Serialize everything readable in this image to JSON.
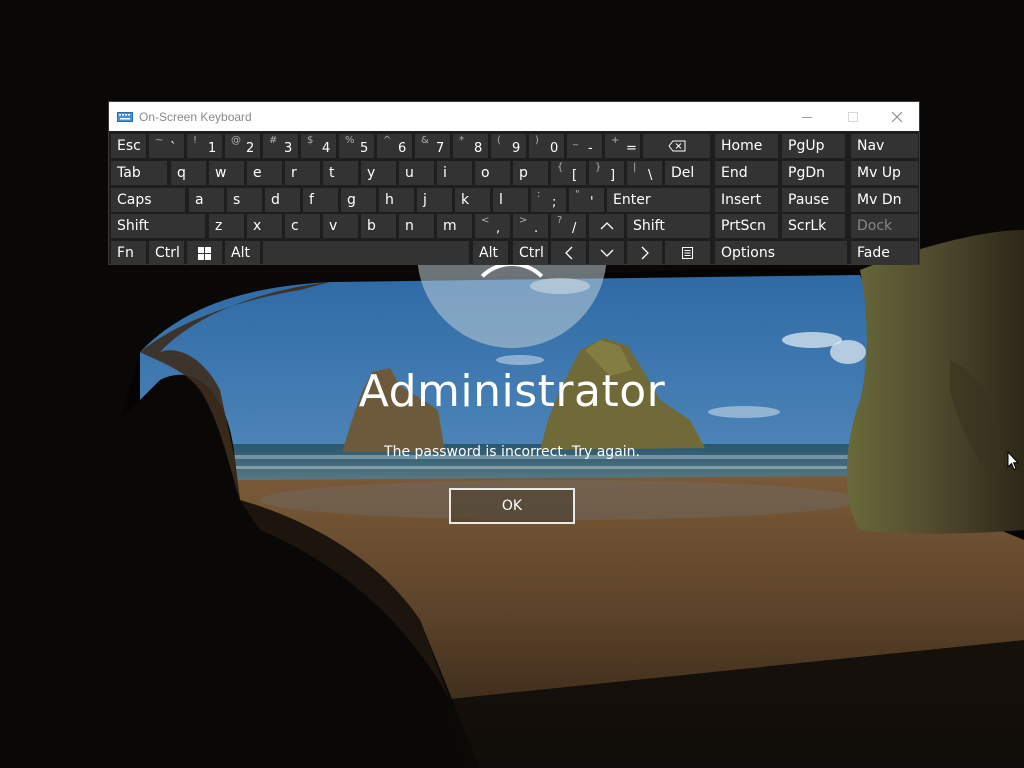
{
  "login": {
    "user_name": "Administrator",
    "message": "The password is incorrect. Try again.",
    "ok_label": "OK"
  },
  "osk": {
    "title": "On-Screen Keyboard",
    "rows": [
      [
        {
          "id": "esc",
          "label": "Esc"
        },
        {
          "id": "tilde",
          "symbol": "~",
          "main": "`"
        },
        {
          "id": "k1",
          "symbol": "!",
          "main": "1"
        },
        {
          "id": "k2",
          "symbol": "@",
          "main": "2"
        },
        {
          "id": "k3",
          "symbol": "#",
          "main": "3"
        },
        {
          "id": "k4",
          "symbol": "$",
          "main": "4"
        },
        {
          "id": "k5",
          "symbol": "%",
          "main": "5"
        },
        {
          "id": "k6",
          "symbol": "^",
          "main": "6"
        },
        {
          "id": "k7",
          "symbol": "&",
          "main": "7"
        },
        {
          "id": "k8",
          "symbol": "*",
          "main": "8"
        },
        {
          "id": "k9",
          "symbol": "(",
          "main": "9"
        },
        {
          "id": "k0",
          "symbol": ")",
          "main": "0"
        },
        {
          "id": "minus",
          "symbol": "_",
          "main": "-"
        },
        {
          "id": "equals",
          "symbol": "+",
          "main": "="
        },
        {
          "id": "backspace",
          "icon": "backspace-icon"
        },
        {
          "id": "home",
          "label": "Home"
        },
        {
          "id": "pgup",
          "label": "PgUp"
        },
        {
          "id": "nav",
          "label": "Nav"
        }
      ],
      [
        {
          "id": "tab",
          "label": "Tab"
        },
        {
          "id": "q",
          "label": "q"
        },
        {
          "id": "w",
          "label": "w"
        },
        {
          "id": "e",
          "label": "e"
        },
        {
          "id": "r",
          "label": "r"
        },
        {
          "id": "t",
          "label": "t"
        },
        {
          "id": "y",
          "label": "y"
        },
        {
          "id": "u",
          "label": "u"
        },
        {
          "id": "i",
          "label": "i"
        },
        {
          "id": "o",
          "label": "o"
        },
        {
          "id": "p",
          "label": "p"
        },
        {
          "id": "lbracket",
          "symbol": "{",
          "main": "["
        },
        {
          "id": "rbracket",
          "symbol": "}",
          "main": "]"
        },
        {
          "id": "backslash",
          "symbol": "|",
          "main": "\\"
        },
        {
          "id": "del",
          "label": "Del"
        },
        {
          "id": "end",
          "label": "End"
        },
        {
          "id": "pgdn",
          "label": "PgDn"
        },
        {
          "id": "mvup",
          "label": "Mv Up"
        }
      ],
      [
        {
          "id": "caps",
          "label": "Caps"
        },
        {
          "id": "a",
          "label": "a"
        },
        {
          "id": "s",
          "label": "s"
        },
        {
          "id": "d",
          "label": "d"
        },
        {
          "id": "f",
          "label": "f"
        },
        {
          "id": "g",
          "label": "g"
        },
        {
          "id": "h",
          "label": "h"
        },
        {
          "id": "j",
          "label": "j"
        },
        {
          "id": "k",
          "label": "k"
        },
        {
          "id": "l",
          "label": "l"
        },
        {
          "id": "semicolon",
          "symbol": ":",
          "main": ";"
        },
        {
          "id": "quote",
          "symbol": "\"",
          "main": "'"
        },
        {
          "id": "enter",
          "label": "Enter"
        },
        {
          "id": "insert",
          "label": "Insert"
        },
        {
          "id": "pause",
          "label": "Pause"
        },
        {
          "id": "mvdn",
          "label": "Mv Dn"
        }
      ],
      [
        {
          "id": "lshift",
          "label": "Shift"
        },
        {
          "id": "z",
          "label": "z"
        },
        {
          "id": "x",
          "label": "x"
        },
        {
          "id": "c",
          "label": "c"
        },
        {
          "id": "v",
          "label": "v"
        },
        {
          "id": "b",
          "label": "b"
        },
        {
          "id": "n",
          "label": "n"
        },
        {
          "id": "m",
          "label": "m"
        },
        {
          "id": "comma",
          "symbol": "<",
          "main": ","
        },
        {
          "id": "period",
          "symbol": ">",
          "main": "."
        },
        {
          "id": "slash",
          "symbol": "?",
          "main": "/"
        },
        {
          "id": "up",
          "icon": "arrow-up-icon"
        },
        {
          "id": "rshift",
          "label": "Shift"
        },
        {
          "id": "prtscn",
          "label": "PrtScn"
        },
        {
          "id": "scrlk",
          "label": "ScrLk"
        },
        {
          "id": "dock",
          "label": "Dock"
        }
      ],
      [
        {
          "id": "fn",
          "label": "Fn"
        },
        {
          "id": "lctrl",
          "label": "Ctrl"
        },
        {
          "id": "win",
          "icon": "windows-logo-icon"
        },
        {
          "id": "lalt",
          "label": "Alt"
        },
        {
          "id": "space",
          "label": ""
        },
        {
          "id": "ralt",
          "label": "Alt"
        },
        {
          "id": "rctrl",
          "label": "Ctrl"
        },
        {
          "id": "left",
          "icon": "arrow-left-icon"
        },
        {
          "id": "down",
          "icon": "arrow-down-icon"
        },
        {
          "id": "right",
          "icon": "arrow-right-icon"
        },
        {
          "id": "menu",
          "icon": "context-menu-icon"
        },
        {
          "id": "options",
          "label": "Options"
        },
        {
          "id": "fade",
          "label": "Fade"
        }
      ]
    ]
  },
  "colors": {
    "key_bg": "#333333",
    "keyboard_bg": "#1e1e1e",
    "text": "#ffffff",
    "disabled_text": "#888888"
  }
}
